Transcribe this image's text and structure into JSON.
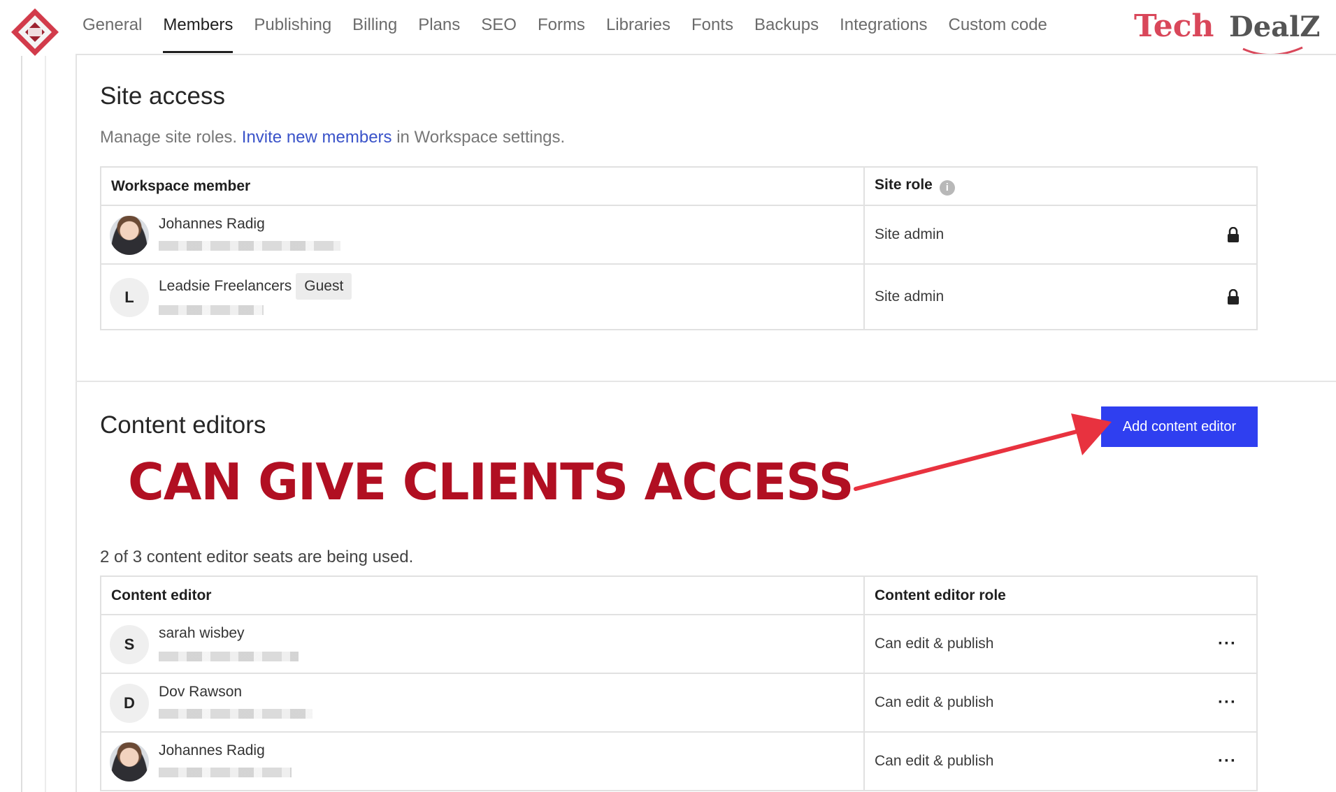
{
  "nav": {
    "tabs": [
      {
        "label": "General",
        "active": false
      },
      {
        "label": "Members",
        "active": true
      },
      {
        "label": "Publishing",
        "active": false
      },
      {
        "label": "Billing",
        "active": false
      },
      {
        "label": "Plans",
        "active": false
      },
      {
        "label": "SEO",
        "active": false
      },
      {
        "label": "Forms",
        "active": false
      },
      {
        "label": "Libraries",
        "active": false
      },
      {
        "label": "Fonts",
        "active": false
      },
      {
        "label": "Backups",
        "active": false
      },
      {
        "label": "Integrations",
        "active": false
      },
      {
        "label": "Custom code",
        "active": false
      }
    ]
  },
  "watermark": {
    "text1": "Tech",
    "text2": "DealZ",
    "color": "#d9475a"
  },
  "site_access": {
    "title": "Site access",
    "subtitle_pre": "Manage site roles.",
    "subtitle_link": "Invite new members",
    "subtitle_post": "in Workspace settings.",
    "columns": [
      "Workspace member",
      "Site role"
    ],
    "rows": [
      {
        "name": "Johannes Radig",
        "avatar": "photo",
        "badge": "",
        "role": "Site admin",
        "icon": "lock-icon"
      },
      {
        "name": "Leadsie Freelancers",
        "avatar": "L",
        "badge": "Guest",
        "role": "Site admin",
        "icon": "lock-icon"
      }
    ]
  },
  "content_editors": {
    "title": "Content editors",
    "add_button": "Add content editor",
    "annotation": "CAN GIVE CLIENTS ACCESS",
    "seats_text": "2 of 3 content editor seats are being used.",
    "columns": [
      "Content editor",
      "Content editor role"
    ],
    "rows": [
      {
        "name": "sarah wisbey",
        "avatar": "S",
        "role": "Can edit & publish",
        "icon": "more-options-icon"
      },
      {
        "name": "Dov Rawson",
        "avatar": "D",
        "role": "Can edit & publish",
        "icon": "more-options-icon"
      },
      {
        "name": "Johannes Radig",
        "avatar": "photo",
        "role": "Can edit & publish",
        "icon": "more-options-icon"
      }
    ]
  },
  "colors": {
    "accent": "#2f3ff0",
    "link": "#3a53c9",
    "annotation": "#b10f22",
    "arrow": "#e8323f"
  }
}
